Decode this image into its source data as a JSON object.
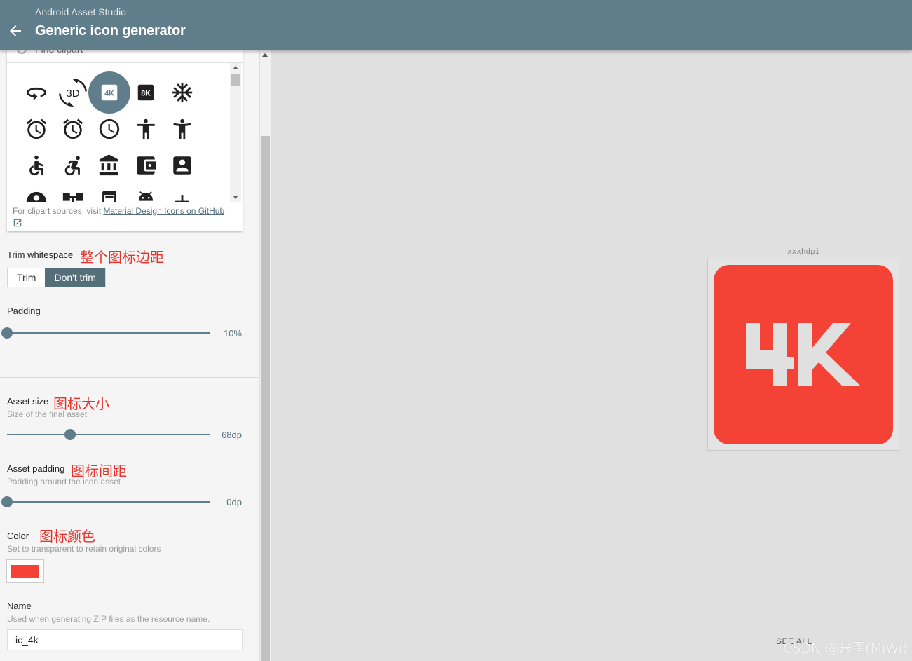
{
  "header": {
    "app_name": "Android Asset Studio",
    "title": "Generic icon generator"
  },
  "clipart": {
    "search_placeholder": "Find clipart",
    "selected_icon": "4k",
    "icons": [
      "360-icon",
      "3d-rotation-icon",
      "4k-icon",
      "8k-icon",
      "ac-unit-icon",
      "access-alarm-icon",
      "access-alarms-icon",
      "access-time-icon",
      "accessibility-icon",
      "accessibility-new-icon",
      "accessible-icon",
      "accessible-forward-icon",
      "account-balance-icon",
      "account-balance-wallet-icon",
      "account-box-icon",
      "account-circle-icon",
      "account-tree-icon",
      "ad-units-icon",
      "adb-icon",
      "add-icon"
    ],
    "icon_3d_text": "3D",
    "footer_prefix": "For clipart sources, visit ",
    "footer_link": "Material Design Icons on GitHub"
  },
  "trim": {
    "label": "Trim whitespace",
    "annotation": "整个图标边距",
    "options": [
      "Trim",
      "Don't trim"
    ],
    "selected": "Don't trim"
  },
  "padding": {
    "label": "Padding",
    "value_text": "-10%",
    "value_fraction": 0.0
  },
  "asset_size": {
    "label": "Asset size",
    "annotation": "图标大小",
    "helper": "Size of the final asset",
    "value_text": "68dp",
    "value_fraction": 0.31
  },
  "asset_padding": {
    "label": "Asset padding",
    "annotation": "图标间距",
    "helper": "Padding around the icon asset",
    "value_text": "0dp",
    "value_fraction": 0.0
  },
  "color": {
    "label": "Color",
    "annotation": "图标颜色",
    "helper": "Set to transparent to retain original colors",
    "value": "#f44336"
  },
  "name": {
    "label": "Name",
    "helper": "Used when generating ZIP files as the resource name.",
    "value": "ic_4k"
  },
  "preview": {
    "density": "xxxhdpi",
    "icon_color": "#f44336",
    "glyph": "4K"
  },
  "see_all": "SEE ALL",
  "watermark": "CSDN @米歪(MiWi)",
  "colors": {
    "primary": "#607d8b",
    "accent_annotation": "#e8322b"
  }
}
